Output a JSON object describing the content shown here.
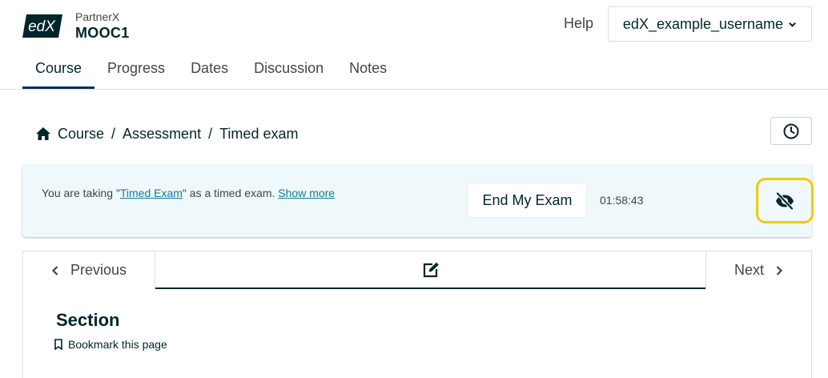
{
  "header": {
    "logo_text": "edX",
    "org": "PartnerX",
    "course_number": "MOOC1",
    "help_label": "Help",
    "username": "edX_example_username"
  },
  "nav_tabs": [
    {
      "label": "Course",
      "active": true
    },
    {
      "label": "Progress",
      "active": false
    },
    {
      "label": "Dates",
      "active": false
    },
    {
      "label": "Discussion",
      "active": false
    },
    {
      "label": "Notes",
      "active": false
    }
  ],
  "breadcrumb": {
    "items": [
      "Course",
      "Assessment",
      "Timed exam"
    ],
    "separator": "/"
  },
  "exam_banner": {
    "prefix": "You are taking \"",
    "exam_name": "Timed Exam",
    "suffix": "\" as a timed exam. ",
    "show_more": "Show more",
    "end_button": "End My Exam",
    "time_remaining": "01:58:43"
  },
  "sequence_nav": {
    "previous_label": "Previous",
    "next_label": "Next"
  },
  "unit": {
    "section_title": "Section",
    "bookmark_label": "Bookmark this page"
  },
  "icons": {
    "home": "home-icon",
    "clock": "clock-icon",
    "hide_timer": "eye-slash-icon",
    "unit": "edit-icon",
    "bookmark": "bookmark-icon"
  },
  "colors": {
    "brand_dark": "#00262b",
    "link": "#0d7d9d",
    "banner_bg": "#eff8fa",
    "focus_ring": "#f0cc00"
  }
}
